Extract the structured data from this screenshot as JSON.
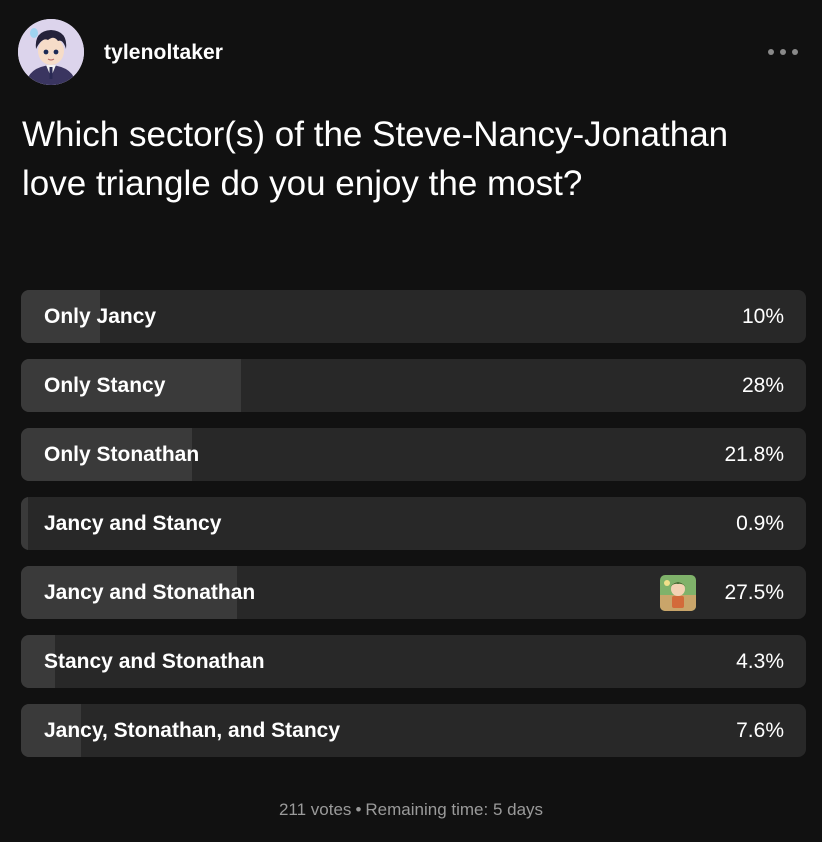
{
  "post": {
    "username": "tylenoltaker",
    "avatar_icon": "anime-avatar-icon",
    "more_icon": "more-options-icon"
  },
  "poll": {
    "question": "Which sector(s) of the Steve-Nancy-Jonathan love triangle do you enjoy the most?",
    "options": [
      {
        "label": "Only Jancy",
        "percent_text": "10%",
        "percent": 10
      },
      {
        "label": "Only Stancy",
        "percent_text": "28%",
        "percent": 28
      },
      {
        "label": "Only Stonathan",
        "percent_text": "21.8%",
        "percent": 21.8
      },
      {
        "label": "Jancy and Stancy",
        "percent_text": "0.9%",
        "percent": 0.9
      },
      {
        "label": "Jancy and Stonathan",
        "percent_text": "27.5%",
        "percent": 27.5,
        "has_voter_avatar": true
      },
      {
        "label": "Stancy and Stonathan",
        "percent_text": "4.3%",
        "percent": 4.3
      },
      {
        "label": "Jancy, Stonathan, and Stancy",
        "percent_text": "7.6%",
        "percent": 7.6
      }
    ],
    "votes": "211 votes",
    "separator": "•",
    "remaining": "Remaining time: 5 days"
  },
  "colors": {
    "background": "#111111",
    "option_bg": "#282828",
    "option_fill": "#3a3a3a",
    "footer_text": "#9a9a9a"
  }
}
